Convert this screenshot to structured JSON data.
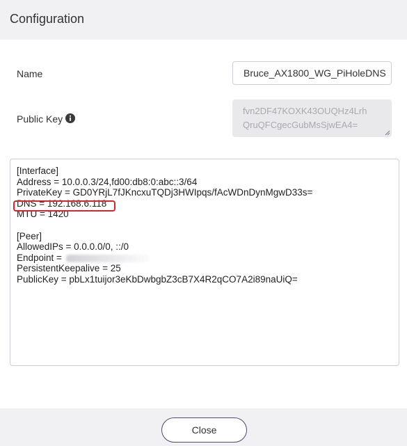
{
  "header": {
    "title": "Configuration"
  },
  "form": {
    "name_label": "Name",
    "name_value": "Bruce_AX1800_WG_PiHoleDNS",
    "public_key_label": "Public Key",
    "public_key_lines": [
      "fvn2DF47KOXK43OUQHz4Lrh",
      "QruQFCgecGubMsSjwEA4="
    ]
  },
  "config": {
    "lines": [
      "[Interface]",
      "Address = 10.0.0.3/24,fd00:db8:0:abc::3/64",
      "PrivateKey = GD0YRjL7fJKncxuTQDj3HWIpqs/fAcWDnDynMgwD33s=",
      "DNS = 192.168.6.118",
      "MTU = 1420",
      "",
      "[Peer]",
      "AllowedIPs = 0.0.0.0/0, ::/0",
      "Endpoint = ",
      "PersistentKeepalive = 25",
      "PublicKey = pbLx1tuijor3eKbDwbgbZ3cB7X4R2qCO7A2i89naUiQ="
    ],
    "highlighted_line": "DNS = 192.168.6.118",
    "highlight_color": "#d6262c"
  },
  "footer": {
    "close_label": "Close"
  },
  "icons": {
    "info": "info-icon",
    "resize": "resize-grip-icon"
  },
  "colors": {
    "header_bg": "#f1f1f4",
    "footer_bg": "#f1f1f4",
    "readonly_bg": "#e9e9ec",
    "button_border": "#4b4b6a"
  }
}
